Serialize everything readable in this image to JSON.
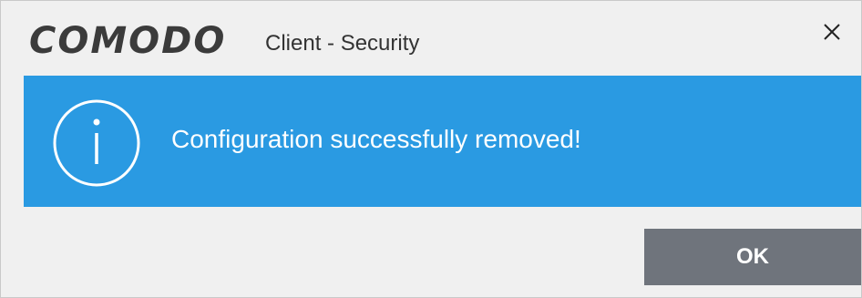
{
  "window": {
    "brand": "COMODO",
    "subtitle": "Client - Security",
    "close_icon": "close-icon"
  },
  "banner": {
    "icon": "info-icon",
    "message": "Configuration successfully removed!",
    "background_color": "#2a9ae2",
    "text_color": "#ffffff"
  },
  "actions": {
    "ok_label": "OK",
    "button_color": "#6f747c"
  }
}
